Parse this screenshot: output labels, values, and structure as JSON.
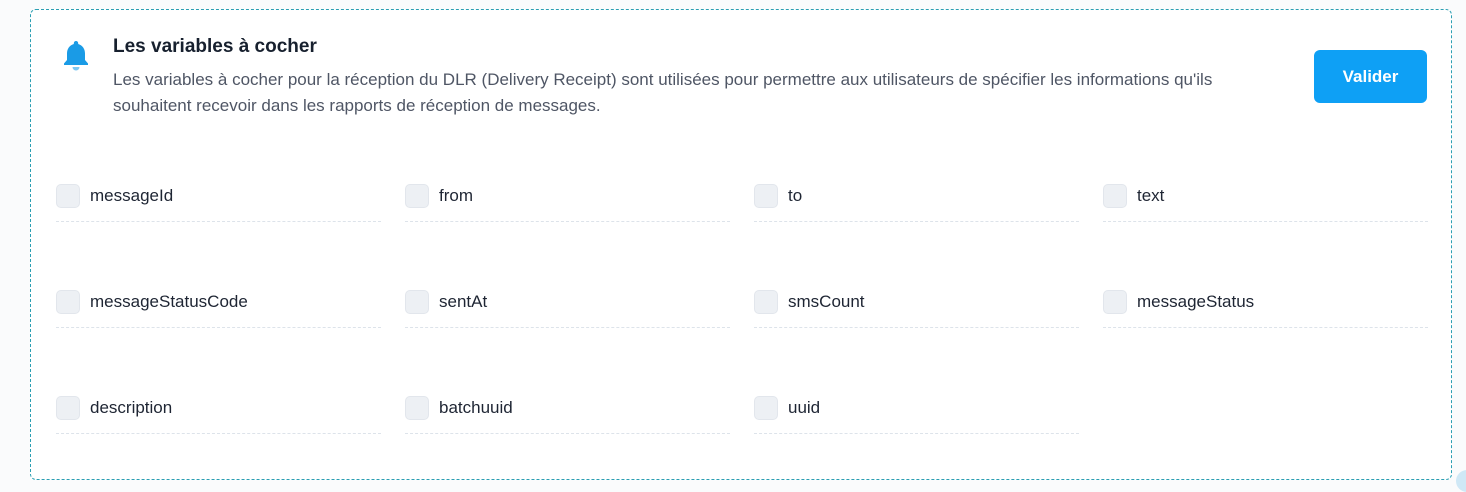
{
  "section": {
    "title": "Les variables à cocher",
    "description": "Les variables à cocher pour la réception du DLR (Delivery Receipt) sont utilisées pour permettre aux utilisateurs de spécifier les informations qu'ils souhaitent recevoir dans les rapports de réception de messages.",
    "icon": "bell-icon",
    "accent_color": "#0ea0f5"
  },
  "actions": {
    "validate_label": "Valider"
  },
  "options": [
    {
      "label": "messageId",
      "checked": false
    },
    {
      "label": "from",
      "checked": false
    },
    {
      "label": "to",
      "checked": false
    },
    {
      "label": "text",
      "checked": false
    },
    {
      "label": "messageStatusCode",
      "checked": false
    },
    {
      "label": "sentAt",
      "checked": false
    },
    {
      "label": "smsCount",
      "checked": false
    },
    {
      "label": "messageStatus",
      "checked": false
    },
    {
      "label": "description",
      "checked": false
    },
    {
      "label": "batchuuid",
      "checked": false
    },
    {
      "label": "uuid",
      "checked": false
    }
  ]
}
